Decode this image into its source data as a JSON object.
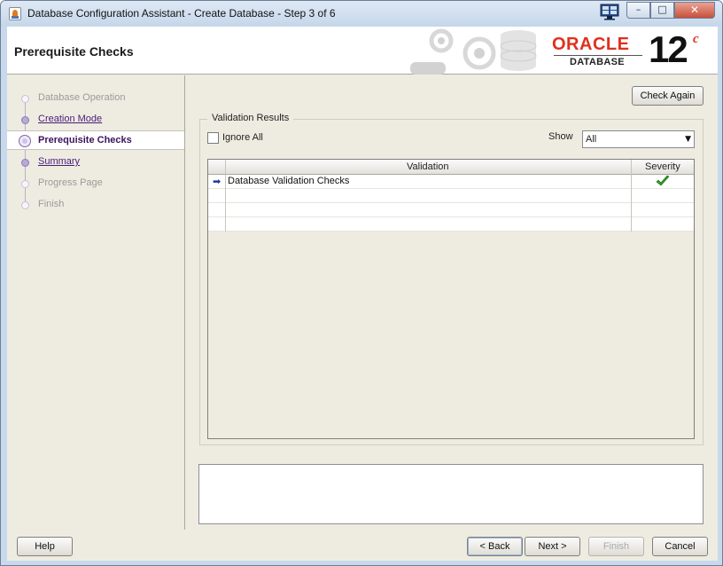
{
  "window": {
    "title": "Database Configuration Assistant - Create Database - Step 3 of 6",
    "controls": {
      "minimize": "–",
      "maximize": "□",
      "close": "✕"
    }
  },
  "header": {
    "title": "Prerequisite Checks",
    "logo_oracle": "ORACLE",
    "logo_database": "DATABASE",
    "version": "12",
    "version_suffix": "c"
  },
  "steps": [
    {
      "label": "Database Operation",
      "state": "disabled"
    },
    {
      "label": "Creation Mode",
      "state": "link"
    },
    {
      "label": "Prerequisite Checks",
      "state": "current"
    },
    {
      "label": "Summary",
      "state": "link"
    },
    {
      "label": "Progress Page",
      "state": "disabled"
    },
    {
      "label": "Finish",
      "state": "disabled"
    }
  ],
  "toolbar": {
    "check_again": "Check Again"
  },
  "validation": {
    "group_title": "Validation Results",
    "ignore_all": "Ignore All",
    "ignore_all_checked": false,
    "show_label": "Show",
    "show_value": "All",
    "columns": {
      "validation": "Validation",
      "severity": "Severity"
    },
    "rows": [
      {
        "label": "Database Validation Checks",
        "severity_icon": "check-icon",
        "severity_color": "#2e9e1e"
      }
    ]
  },
  "footer": {
    "help": "Help",
    "back": "< Back",
    "next": "Next >",
    "finish": "Finish",
    "cancel": "Cancel"
  },
  "colors": {
    "nav_link": "#4b1b7a",
    "oracle_red": "#e0301e",
    "panel_bg": "#eeece1"
  }
}
